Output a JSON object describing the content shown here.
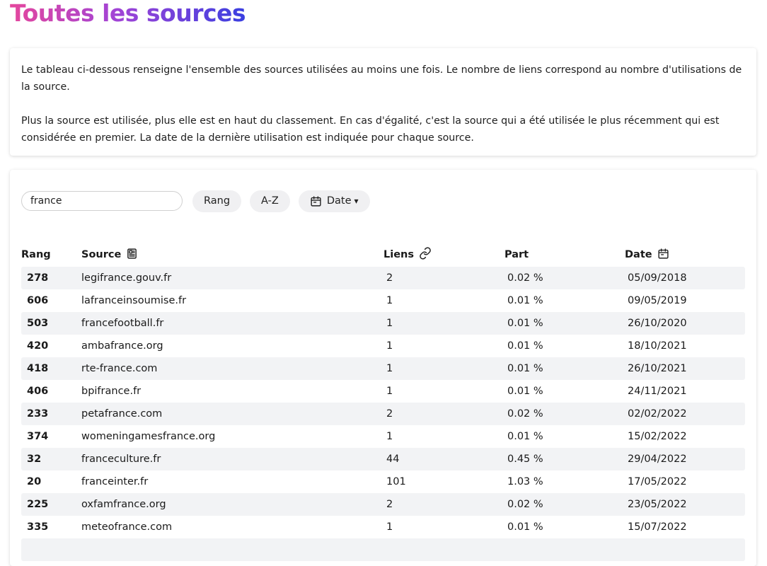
{
  "title": "Toutes les sources",
  "intro": {
    "p1": "Le tableau ci-dessous renseigne l'ensemble des sources utilisées au moins une fois. Le nombre de liens correspond au nombre d'utilisations de la source.",
    "p2": "Plus la source est utilisée, plus elle est en haut du classement. En cas d'égalité, c'est la source qui a été utilisée le plus récemment qui est considérée en premier. La date de la dernière utilisation est indiquée pour chaque source."
  },
  "controls": {
    "search_value": "france",
    "sort_rank_label": "Rang",
    "sort_az_label": "A-Z",
    "sort_date_label": "Date",
    "sort_date_caret": "▾"
  },
  "table": {
    "headers": {
      "rang": "Rang",
      "source": "Source",
      "liens": "Liens",
      "part": "Part",
      "date": "Date"
    },
    "rows": [
      {
        "rang": "278",
        "source": "legifrance.gouv.fr",
        "liens": "2",
        "part": "0.02 %",
        "date": "05/09/2018"
      },
      {
        "rang": "606",
        "source": "lafranceinsoumise.fr",
        "liens": "1",
        "part": "0.01 %",
        "date": "09/05/2019"
      },
      {
        "rang": "503",
        "source": "francefootball.fr",
        "liens": "1",
        "part": "0.01 %",
        "date": "26/10/2020"
      },
      {
        "rang": "420",
        "source": "ambafrance.org",
        "liens": "1",
        "part": "0.01 %",
        "date": "18/10/2021"
      },
      {
        "rang": "418",
        "source": "rte-france.com",
        "liens": "1",
        "part": "0.01 %",
        "date": "26/10/2021"
      },
      {
        "rang": "406",
        "source": "bpifrance.fr",
        "liens": "1",
        "part": "0.01 %",
        "date": "24/11/2021"
      },
      {
        "rang": "233",
        "source": "petafrance.com",
        "liens": "2",
        "part": "0.02 %",
        "date": "02/02/2022"
      },
      {
        "rang": "374",
        "source": "womeningamesfrance.org",
        "liens": "1",
        "part": "0.01 %",
        "date": "15/02/2022"
      },
      {
        "rang": "32",
        "source": "franceculture.fr",
        "liens": "44",
        "part": "0.45 %",
        "date": "29/04/2022"
      },
      {
        "rang": "20",
        "source": "franceinter.fr",
        "liens": "101",
        "part": "1.03 %",
        "date": "17/05/2022"
      },
      {
        "rang": "225",
        "source": "oxfamfrance.org",
        "liens": "2",
        "part": "0.02 %",
        "date": "23/05/2022"
      },
      {
        "rang": "335",
        "source": "meteofrance.com",
        "liens": "1",
        "part": "0.01 %",
        "date": "15/07/2022"
      }
    ]
  },
  "icons": {
    "calendar": "calendar-icon",
    "newspaper": "newspaper-icon",
    "link": "link-icon"
  },
  "colors": {
    "title_gradient_start": "#e5479d",
    "title_gradient_mid": "#a244d6",
    "title_gradient_end": "#3a3fe0",
    "row_stripe": "#f2f3f5",
    "pill_bg": "#f0f0f2"
  }
}
